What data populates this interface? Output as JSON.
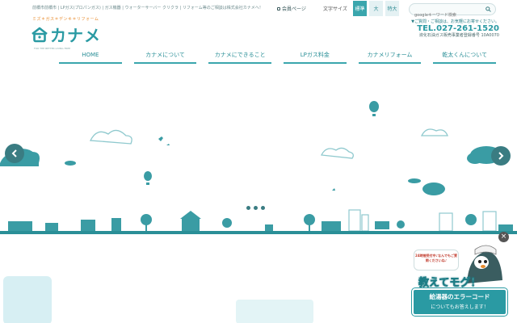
{
  "header": {
    "tagline": "前橋市前橋市 | LPガス(プロパンガス) | ガス機器 | ウォーターサーバー クリクラ | リフォーム等のご相談は株式会社カナメへ！",
    "member_link": "会員ページ",
    "font_size_label": "文字サイズ",
    "font_sizes": [
      "標準",
      "大",
      "特大"
    ],
    "search_placeholder": "googleキーワード検索"
  },
  "logo": {
    "subtitle": "ミズ＊ガス＊デンキ＊リフォーム",
    "name": "カナメ",
    "english": "FOR THE BETTER LIVING FREE"
  },
  "contact": {
    "note": "▼ご質問・ご相談は、お気軽にお寄せください。",
    "phone": "TEL.027-261-1520",
    "registration": "液化石油ガス販売事業者登録番号 10A0070"
  },
  "nav": {
    "items": [
      "HOME",
      "カナメについて",
      "カナメにできること",
      "LPガス料金",
      "カナメリフォーム",
      "乾太くんについて"
    ]
  },
  "slider": {
    "current": 1,
    "total": 3
  },
  "promo": {
    "bubble": "24時間受付中♪なんでもご質問くださいね♪",
    "title": "教えてモグ！",
    "line1": "給湯器のエラーコード",
    "line2": "についてもお答えします！"
  },
  "colors": {
    "accent": "#2a9aa3",
    "dark": "#3a7c82",
    "orange": "#e88b2c"
  }
}
